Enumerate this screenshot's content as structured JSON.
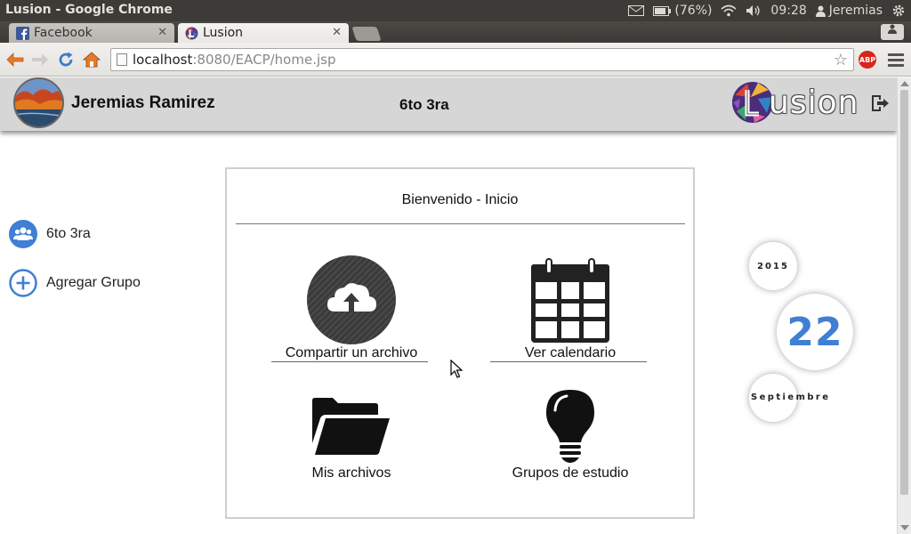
{
  "os": {
    "window_title": "Lusion - Google Chrome",
    "battery": "(76%)",
    "time": "09:28",
    "user": "Jeremias"
  },
  "tabs": [
    {
      "label": "Facebook",
      "icon": "facebook-icon",
      "active": false
    },
    {
      "label": "Lusion",
      "icon": "lusion-favicon",
      "active": true
    }
  ],
  "toolbar": {
    "url_host": "localhost",
    "url_path": ":8080/EACP/home.jsp",
    "adblock_label": "ABP"
  },
  "header": {
    "user_name": "Jeremias Ramirez",
    "group_name": "6to 3ra",
    "logo_text": "usion",
    "logo_letter": "L"
  },
  "sidebar": {
    "items": [
      {
        "label": "6to 3ra",
        "icon": "group-icon"
      },
      {
        "label": "Agregar Grupo",
        "icon": "add-circle-icon"
      }
    ]
  },
  "panel": {
    "title": "Bienvenido - Inicio",
    "tiles": [
      {
        "label": "Compartir un archivo",
        "icon": "cloud-upload-icon"
      },
      {
        "label": "Ver calendario",
        "icon": "calendar-icon"
      },
      {
        "label": "Mis archivos",
        "icon": "folder-icon"
      },
      {
        "label": "Grupos de estudio",
        "icon": "lightbulb-icon"
      }
    ]
  },
  "date": {
    "year": "2015",
    "day": "22",
    "month": "Septiembre"
  },
  "colors": {
    "accent_blue": "#3f7fd4",
    "header_bg": "#d6d6d6",
    "os_bar": "#3c3b37"
  }
}
